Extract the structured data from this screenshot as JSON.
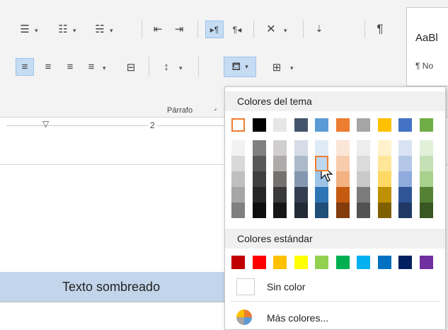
{
  "ribbon": {
    "group_label": "Párrafo",
    "style_preview": "AaBl",
    "style_name": "¶ No"
  },
  "ruler": {
    "mark": "2"
  },
  "document": {
    "shaded_text": "Texto sombreado"
  },
  "shading_menu": {
    "theme_header": "Colores del tema",
    "standard_header": "Colores estándar",
    "no_color_label": "Sin color",
    "more_colors_label": "Más colores...",
    "theme_colors": [
      "#ffffff",
      "#000000",
      "#e7e6e6",
      "#44546a",
      "#5b9bd5",
      "#ed7d31",
      "#a5a5a5",
      "#ffc000",
      "#4472c4",
      "#70ad47"
    ],
    "theme_shades": [
      [
        "#f2f2f2",
        "#d9d9d9",
        "#bfbfbf",
        "#a6a6a6",
        "#808080"
      ],
      [
        "#808080",
        "#595959",
        "#404040",
        "#262626",
        "#0d0d0d"
      ],
      [
        "#d0cece",
        "#aeaaaa",
        "#767171",
        "#3a3838",
        "#171616"
      ],
      [
        "#d6dce5",
        "#acb9ca",
        "#8497b0",
        "#333f50",
        "#222a35"
      ],
      [
        "#deebf7",
        "#bdd7ee",
        "#9dc3e6",
        "#2e75b6",
        "#1f4e79"
      ],
      [
        "#fbe5d6",
        "#f8cbad",
        "#f4b183",
        "#c55a11",
        "#843c0c"
      ],
      [
        "#ededed",
        "#dbdbdb",
        "#c9c9c9",
        "#7b7b7b",
        "#525252"
      ],
      [
        "#fff2cc",
        "#ffe699",
        "#ffd966",
        "#bf9000",
        "#7f6000"
      ],
      [
        "#dae3f3",
        "#b4c7e7",
        "#8faadc",
        "#2f5597",
        "#203864"
      ],
      [
        "#e2f0d9",
        "#c5e0b4",
        "#a9d18e",
        "#548235",
        "#385723"
      ]
    ],
    "standard_colors": [
      "#c00000",
      "#ff0000",
      "#ffc000",
      "#ffff00",
      "#92d050",
      "#00b050",
      "#00b0f0",
      "#0070c0",
      "#002060",
      "#7030a0"
    ],
    "selected_theme_color_index": 0,
    "hovered_shade": {
      "column": 4,
      "row": 1
    },
    "highlight_color": "#ed7d31"
  }
}
